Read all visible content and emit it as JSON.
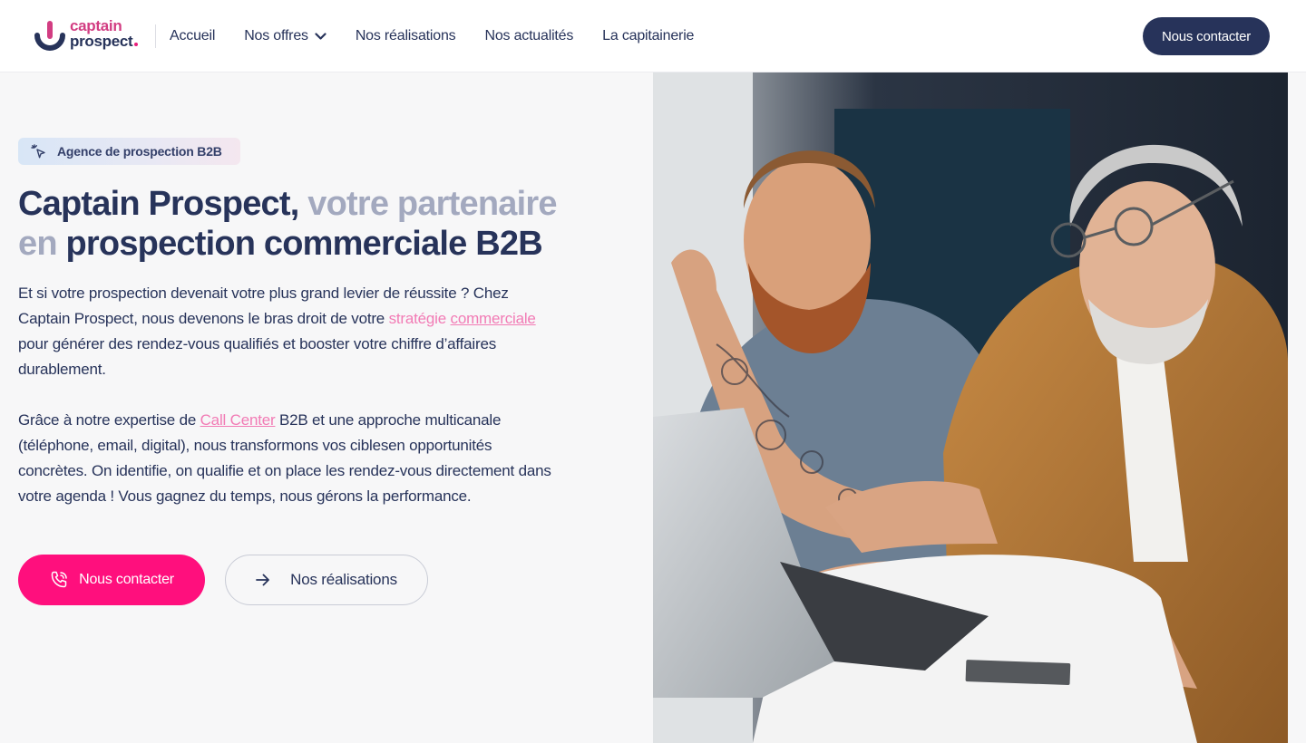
{
  "header": {
    "logo": {
      "line1": "captain",
      "line2": "prospect",
      "icon": "captain-prospect-logo-icon"
    },
    "nav": [
      {
        "label": "Accueil"
      },
      {
        "label": "Nos offres",
        "icon": "chevron-down-icon"
      },
      {
        "label": "Nos réalisations"
      },
      {
        "label": "Nos actualités"
      },
      {
        "label": "La capitainerie"
      }
    ],
    "cta_label": "Nous contacter"
  },
  "hero": {
    "badge": {
      "icon": "sparkle-cursor-icon",
      "label": "Agence de prospection B2B"
    },
    "title": {
      "part1": "Captain Prospect,",
      "part2": "votre partenaire en",
      "part3": "prospection commerciale B2B"
    },
    "paragraph1": {
      "before": "Et si votre prospection devenait votre plus grand levier de réussite ? Chez Captain Prospect, nous devenons le bras droit de votre ",
      "link1": "stratégie",
      "link2": "commerciale",
      "after": " pour générer des rendez-vous qualifiés et booster votre chiffre d’affaires durablement."
    },
    "paragraph2": {
      "before": "Grâce à notre expertise de ",
      "link": "Call Center",
      "after": " B2B et une approche multicanale (téléphone, email, digital), nous transformons vos ciblesen opportunités concrètes. On identifie, on qualifie et on place les rendez-vous directement dans votre agenda ! Vous gagnez du temps, nous gérons la performance."
    },
    "buttons": {
      "primary": {
        "label": "Nous contacter",
        "icon": "phone-icon"
      },
      "secondary": {
        "label": "Nos réalisations",
        "icon": "arrow-right-icon"
      }
    }
  },
  "colors": {
    "navy": "#27335a",
    "pink": "#ff0f7d",
    "link_pink": "#f27bb5",
    "muted": "#a3a9bf",
    "background": "#f7f7f8"
  }
}
